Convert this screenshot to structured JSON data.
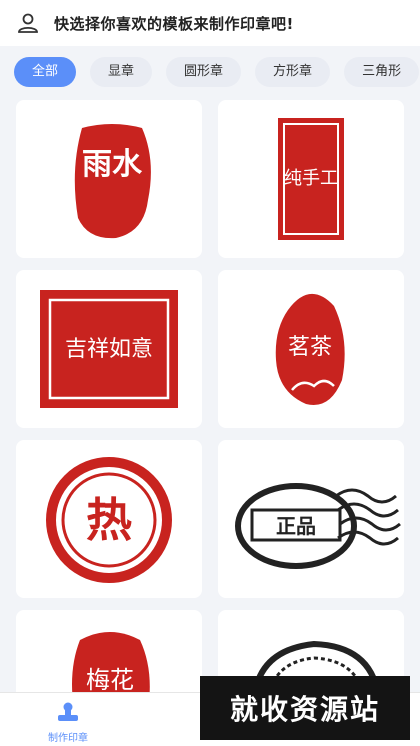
{
  "header": {
    "title": "快选择你喜欢的模板来制作印章吧!"
  },
  "tabs": [
    {
      "label": "全部",
      "active": true
    },
    {
      "label": "显章",
      "active": false
    },
    {
      "label": "圆形章",
      "active": false
    },
    {
      "label": "方形章",
      "active": false
    },
    {
      "label": "三角形",
      "active": false
    }
  ],
  "stamps": [
    {
      "text": "雨水"
    },
    {
      "text": "纯手工"
    },
    {
      "text": "吉祥如意"
    },
    {
      "text": "茗茶"
    },
    {
      "text": "热"
    },
    {
      "text": "正品"
    },
    {
      "text": "梅花"
    }
  ],
  "nav": {
    "make_stamp": "制作印章"
  },
  "watermark": "就收资源站",
  "colors": {
    "accent": "#5b8ff9",
    "stamp_red": "#c8231f",
    "stamp_dark": "#222222"
  }
}
